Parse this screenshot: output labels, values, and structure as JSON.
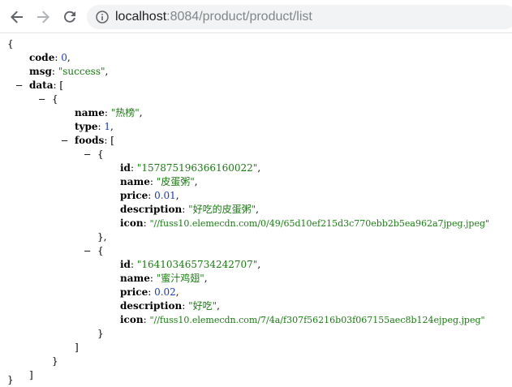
{
  "browser": {
    "url_host": "localhost",
    "url_path": ":8084/product/product/list"
  },
  "json": {
    "open_brace": "{",
    "close_brace": "}",
    "open_bracket": "[",
    "close_bracket": "]",
    "close_brace_comma": "},",
    "collapse_toggle": "–",
    "keys": {
      "code": "code",
      "msg": "msg",
      "data": "data",
      "name": "name",
      "type": "type",
      "foods": "foods",
      "id": "id",
      "price": "price",
      "description": "description",
      "icon": "icon"
    },
    "code": "0",
    "msg": "success",
    "data": [
      {
        "name": "热榜",
        "type": "1",
        "foods": [
          {
            "id": "157875196366160022",
            "name": "皮蛋粥",
            "price": "0.01",
            "description": "好吃的皮蛋粥",
            "icon": "//fuss10.elemecdn.com/0/49/65d10ef215d3c770ebb2b5ea962a7jpeg.jpeg"
          },
          {
            "id": "164103465734242707",
            "name": "蜜汁鸡翅",
            "price": "0.02",
            "description": "好吃",
            "icon": "//fuss10.elemecdn.com/7/4a/f307f56216b03f067155aec8b124ejpeg.jpeg"
          }
        ]
      }
    ]
  }
}
